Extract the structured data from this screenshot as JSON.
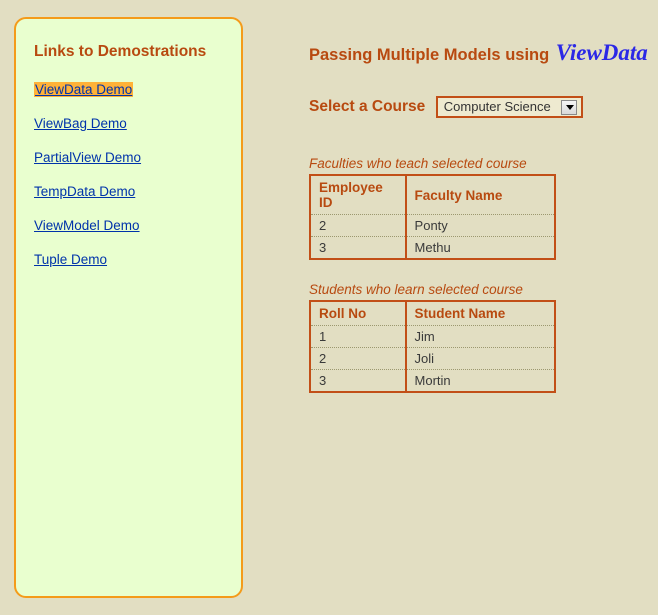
{
  "sidebar": {
    "title": "Links to Demostrations",
    "items": [
      {
        "label": "ViewData Demo",
        "active": true
      },
      {
        "label": "ViewBag Demo",
        "active": false
      },
      {
        "label": "PartialView Demo",
        "active": false
      },
      {
        "label": "TempData Demo",
        "active": false
      },
      {
        "label": "ViewModel Demo",
        "active": false
      },
      {
        "label": "Tuple Demo",
        "active": false
      }
    ]
  },
  "main": {
    "title_prefix": "Passing Multiple Models using",
    "title_keyword": "ViewData",
    "select_label": "Select a Course",
    "select_value": "Computer Science",
    "faculties": {
      "caption": "Faculties who teach selected course",
      "columns": [
        "Employee ID",
        "Faculty Name"
      ],
      "rows": [
        [
          "2",
          "Ponty"
        ],
        [
          "3",
          "Methu"
        ]
      ]
    },
    "students": {
      "caption": "Students who learn selected course",
      "columns": [
        "Roll No",
        "Student Name"
      ],
      "rows": [
        [
          "1",
          "Jim"
        ],
        [
          "2",
          "Joli"
        ],
        [
          "3",
          "Mortin"
        ]
      ]
    }
  }
}
